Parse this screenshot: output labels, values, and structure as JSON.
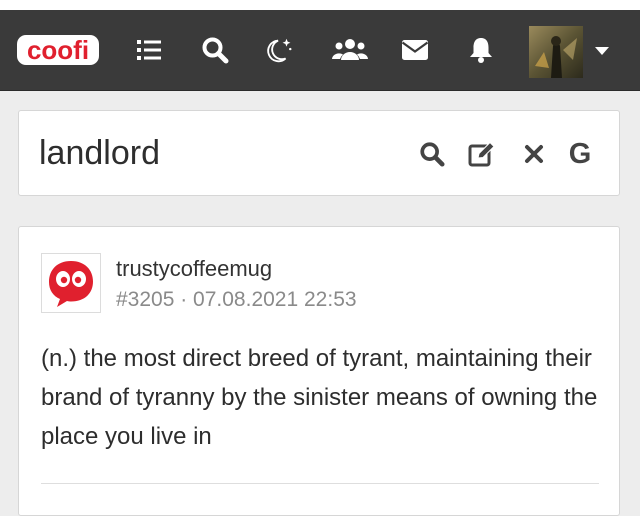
{
  "header": {
    "logo_text": "coofi",
    "icons": [
      "list-icon",
      "search-icon",
      "moon-stars-icon",
      "users-icon",
      "envelope-icon",
      "bell-icon"
    ],
    "colors": {
      "bar": "#3a3a3a",
      "logo": "#e0202e",
      "icon": "#ffffff"
    }
  },
  "search": {
    "term": "landlord",
    "tools": [
      "search-icon",
      "edit-icon",
      "close-icon"
    ],
    "google_label": "G"
  },
  "entry": {
    "author": "trustycoffeemug",
    "meta": "#3205 · 07.08.2021 22:53",
    "body": "(n.) the most direct breed of tyrant, maintaining their brand of tyranny by the sinister means of owning the place you live in"
  }
}
